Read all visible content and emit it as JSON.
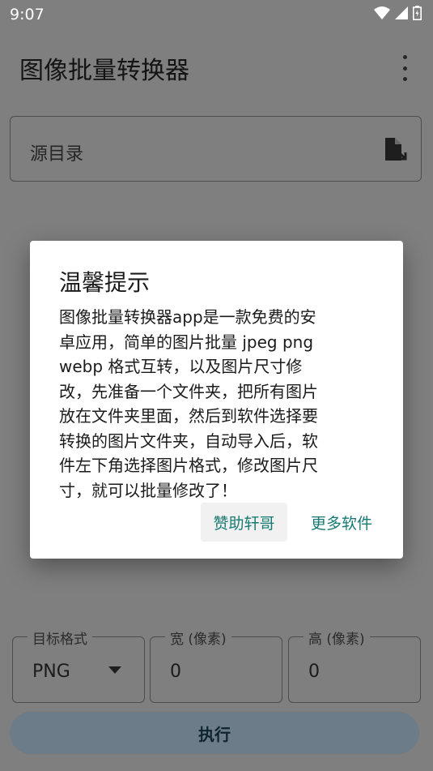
{
  "status_bar": {
    "time": "9:07"
  },
  "app_bar": {
    "title": "图像批量转换器"
  },
  "source": {
    "label": "源目录"
  },
  "dialog": {
    "title": "温馨提示",
    "body_lines": [
      "图像批量转换器app是一款免费的安",
      "卓应用，简单的图片批量 jpeg png",
      "webp 格式互转，以及图片尺寸修",
      "改，先准备一个文件夹，把所有图片",
      "放在文件夹里面，然后到软件选择要",
      "转换的图片文件夹，自动导入后，软",
      "件左下角选择图片格式，修改图片尺",
      "寸，就可以批量修改了！"
    ],
    "sponsor_button": "赞助轩哥",
    "more_button": "更多软件"
  },
  "options": {
    "format_label": "目标格式",
    "format_value": "PNG",
    "width_label": "宽 (像素)",
    "width_value": "0",
    "height_label": "高 (像素)",
    "height_value": "0"
  },
  "execute_button": "执行"
}
